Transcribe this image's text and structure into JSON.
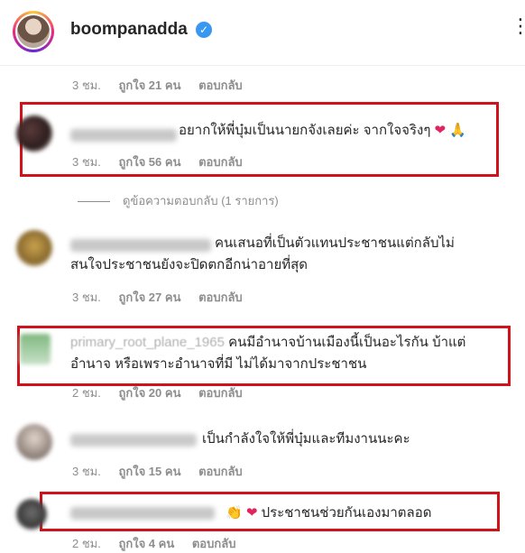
{
  "header": {
    "username": "boompanadda",
    "verified_icon": "✓",
    "more_icon": "⋮"
  },
  "comments": [
    {
      "time": "3 ชม.",
      "likes": "ถูกใจ 21 คน",
      "reply": "ตอบกลับ"
    },
    {
      "text": "อยากให้พี่บุ๋มเป็นนายกจังเลยค่ะ จากใจจริงๆ",
      "emoji": "❤ 🙏",
      "time": "3 ชม.",
      "likes": "ถูกใจ 56 คน",
      "reply": "ตอบกลับ"
    },
    {
      "text": "คนเสนอที่เป็นตัวแทนประชาชนแต่กลับไม่สนใจประชาชนยังจะปิดตกอีกน่าอายที่สุด",
      "time": "3 ชม.",
      "likes": "ถูกใจ 27 คน",
      "reply": "ตอบกลับ"
    },
    {
      "username": "primary_root_plane_1965",
      "text": "คนมีอำนาจบ้านเมืองนี้เป็นอะไรกัน บ้าแต่อำนาจ หรือเพราะอำนาจที่มี ไม่ได้มาจากประชาชน",
      "time": "2 ชม.",
      "likes": "ถูกใจ 20 คน",
      "reply": "ตอบกลับ"
    },
    {
      "text": "เป็นกำลังใจให้พี่บุ๋มและทีมงานนะคะ",
      "time": "3 ชม.",
      "likes": "ถูกใจ 15 คน",
      "reply": "ตอบกลับ"
    },
    {
      "text": "ประชาชนช่วยกันเองมาตลอด",
      "emoji": "👏 ❤",
      "time": "2 ชม.",
      "likes": "ถูกใจ 4 คน",
      "reply": "ตอบกลับ"
    }
  ],
  "view_replies": "ดูข้อความตอบกลับ (1 รายการ)",
  "colors": {
    "highlight": "#d0121b",
    "verified": "#3897f0",
    "muted": "#8e8e8e"
  }
}
